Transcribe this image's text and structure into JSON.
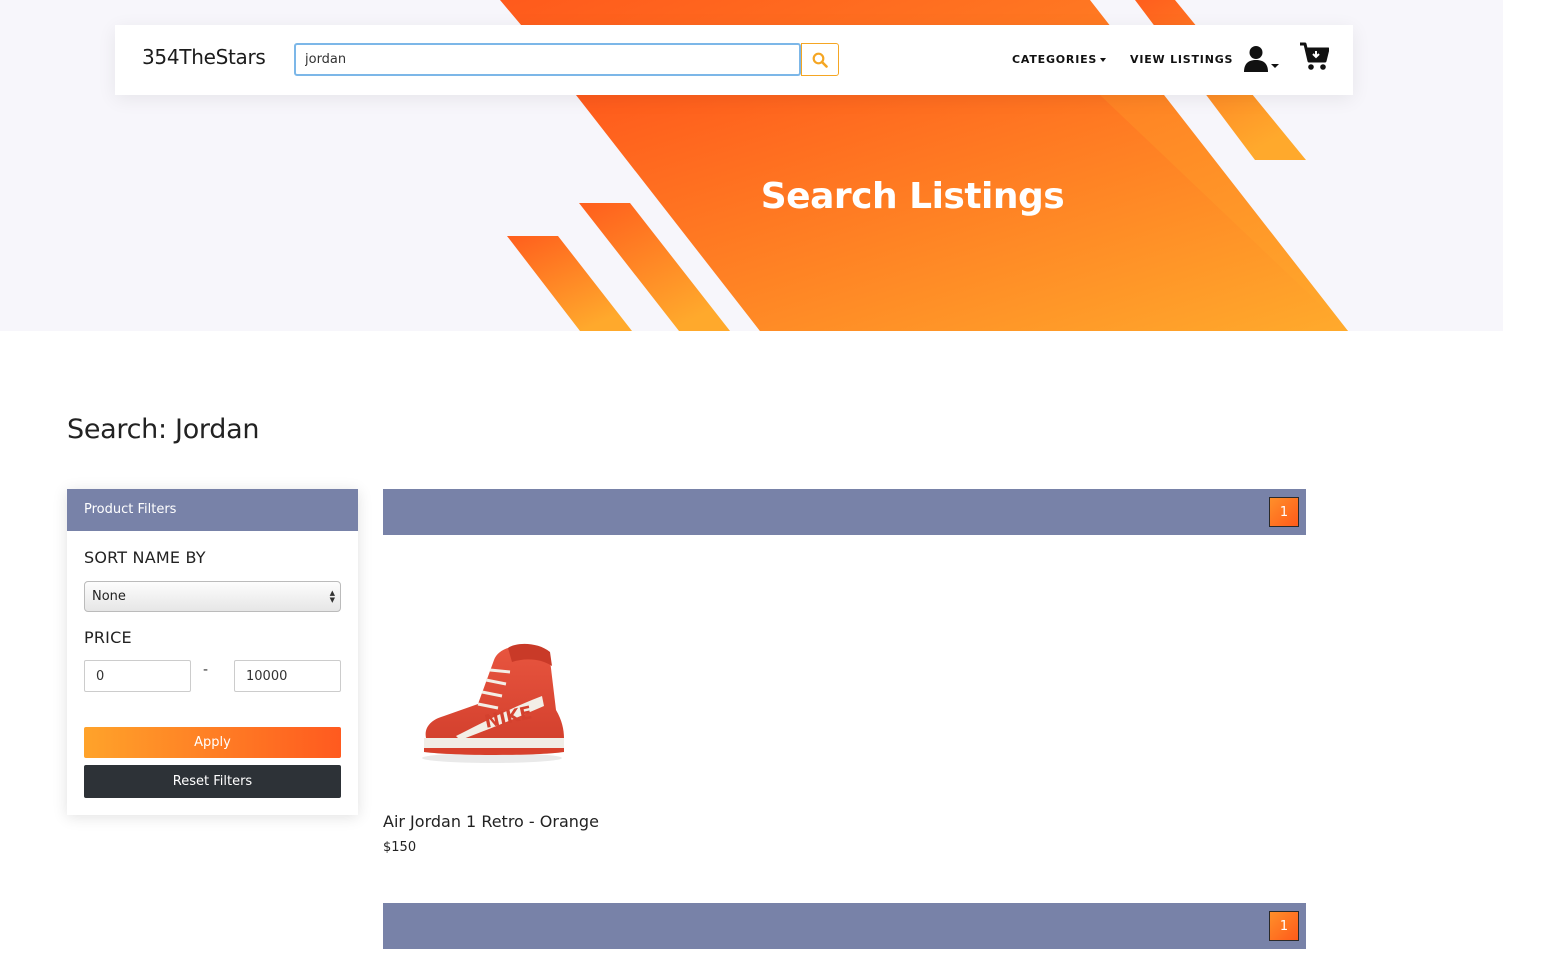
{
  "brand": "354TheStars",
  "search": {
    "value": "jordan"
  },
  "nav": {
    "categories": "CATEGORIES",
    "view_listings": "VIEW LISTINGS"
  },
  "hero": {
    "title": "Search Listings"
  },
  "page": {
    "heading": "Search: Jordan"
  },
  "filters": {
    "header": "Product Filters",
    "sort_label": "SORT NAME BY",
    "sort_selected": "None",
    "price_label": "PRICE",
    "price_min": "0",
    "price_dash": "-",
    "price_max": "10000",
    "apply": "Apply",
    "reset": "Reset Filters"
  },
  "pagination": {
    "current_page": "1"
  },
  "products": [
    {
      "name": "Air Jordan 1 Retro - Orange",
      "price": "$150"
    }
  ],
  "colors": {
    "accent": "#ff6a1f",
    "accent_light": "#ffa32a",
    "panel_header": "#7882a8",
    "dark_button": "#2d3237"
  },
  "icons": [
    "search-icon",
    "user-icon",
    "cart-icon"
  ]
}
